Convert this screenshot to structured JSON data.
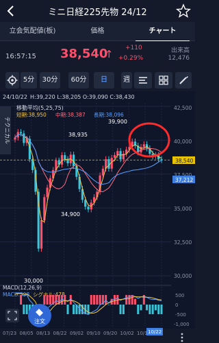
{
  "header": {
    "title": "ミニ日経225先物 24/12"
  },
  "tabs": [
    {
      "label": "立会気配値(板)",
      "active": false
    },
    {
      "label": "価格",
      "active": false
    },
    {
      "label": "チャート",
      "active": true
    }
  ],
  "quote": {
    "time": "16:57:15",
    "price": "38,540",
    "direction": "↑",
    "change": "+110",
    "change_pct": "+0.29%",
    "volume_label": "出来高",
    "volume": "12,476"
  },
  "toolbar": {
    "timeframes": [
      "5分",
      "30分",
      "60分",
      "日",
      "週"
    ],
    "selected": "日",
    "icons": [
      "settings-icon",
      "bar-style-icon",
      "layout-grid-icon",
      "draw-tool-icon"
    ]
  },
  "ohlc": {
    "date": "24/10/22",
    "text": "H:39,220 L:38,205 O:39,090 C:38,430"
  },
  "indicator": {
    "name": "移動平均(5,25,75)",
    "short": "短期:38,950",
    "mid": "中期:38,387",
    "long": "長期:38,096"
  },
  "side_tab": "テクニカル",
  "macd": {
    "label": "MACD(12,26,9)",
    "macd_value": "MACD:398",
    "signal": "シグナル:478",
    "axis": [
      "500",
      "0",
      "-500",
      "-1,000"
    ]
  },
  "order_button": "注文",
  "price_axis": [
    "42,500",
    "40,000",
    "37,500",
    "35,000",
    "32,500",
    "30,000"
  ],
  "price_tags": {
    "last": "38,540",
    "ref": "37,212"
  },
  "annotations": {
    "peak1": "38,935",
    "peak2": "39,900",
    "trough1": "34,900",
    "low": "30,000"
  },
  "date_axis": [
    "07/23",
    "08/05",
    "08/13",
    "08/22",
    "09/02",
    "09/10",
    "09/20",
    "10/02",
    "10/1",
    "10/22"
  ],
  "colors": {
    "background": "#141a2a",
    "up": "#ff4f6a",
    "down": "#39c4d8",
    "accent": "#4a86e8",
    "ma_short": "#f2c94c",
    "ma_mid": "#ff6b7d",
    "ma_long": "#5aa0ff",
    "highlight_circle": "#ff2a2a"
  },
  "chart_data": {
    "type": "candlestick",
    "x_first": "07/23",
    "x_last": "10/22",
    "ylim": [
      30000,
      42500
    ],
    "close_series": [
      40200,
      40600,
      40500,
      39800,
      40100,
      38600,
      37800,
      36200,
      32000,
      34100,
      35800,
      36500,
      37200,
      37800,
      38500,
      38200,
      38900,
      38600,
      38300,
      38935,
      38100,
      37300,
      36400,
      35600,
      35100,
      34900,
      35400,
      35800,
      36200,
      37400,
      37900,
      38600,
      37900,
      38700,
      38900,
      39200,
      38600,
      39000,
      39300,
      39500,
      39900,
      39600,
      39100,
      39500,
      39700,
      39400,
      39000,
      38800,
      38900,
      38600,
      38540
    ],
    "ma_short_last": 38950,
    "ma_mid_last": 38387,
    "ma_long_last": 38096,
    "macd_last": 398,
    "signal_last": 478
  }
}
